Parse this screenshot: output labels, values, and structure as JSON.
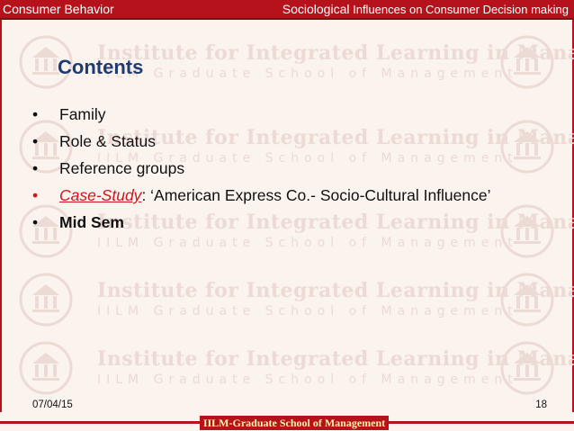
{
  "header": {
    "left": "Consumer Behavior",
    "right_big": "Sociological",
    "right_small": " Influences on Consumer Decision making"
  },
  "watermark": {
    "title": "Institute for Integrated Learning in Management",
    "subtitle": "IILM Graduate School of Management",
    "emblem_text": "IILM"
  },
  "slide": {
    "title": "Contents",
    "bullets": {
      "b1": "Family",
      "b2": "Role & Status",
      "b3": "Reference groups",
      "b4_label": "Case-Study",
      "b4_text": ": ‘American Express Co.- Socio-Cultural Influence’",
      "b5": "Mid Sem"
    },
    "bullet_symbol": "•"
  },
  "footer": {
    "date": "07/04/15",
    "page": "18",
    "institution": "IILM-Graduate School of Management"
  },
  "colors": {
    "accent": "#b6121b",
    "title": "#1f3b73",
    "case_study": "#d2131c"
  }
}
